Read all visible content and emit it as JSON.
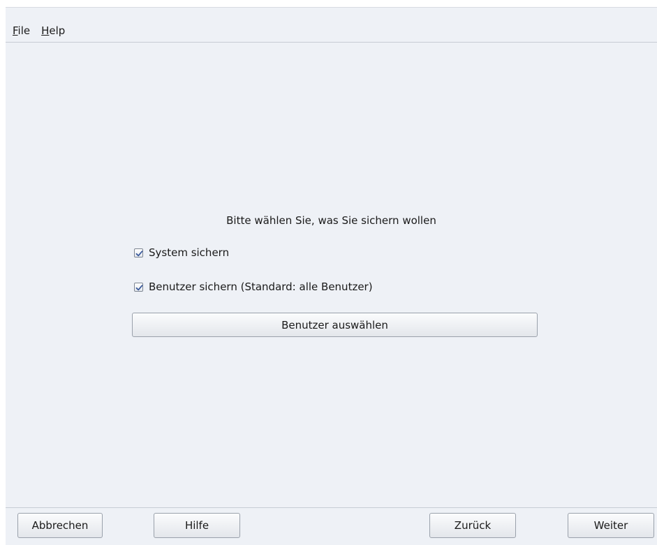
{
  "menubar": {
    "file": {
      "mnemonic": "F",
      "rest": "ile"
    },
    "help": {
      "mnemonic": "H",
      "rest": "elp"
    }
  },
  "main": {
    "prompt": "Bitte wählen Sie, was Sie sichern wollen",
    "options": [
      {
        "label": "System sichern",
        "checked": true
      },
      {
        "label": "Benutzer sichern (Standard: alle Benutzer)",
        "checked": true
      }
    ],
    "select_users_label": "Benutzer auswählen"
  },
  "footer": {
    "cancel_label": "Abbrechen",
    "help_label": "Hilfe",
    "back_label": "Zurück",
    "next_label": "Weiter"
  },
  "colors": {
    "background": "#eef1f6",
    "checkmark": "#3a5a9c"
  }
}
